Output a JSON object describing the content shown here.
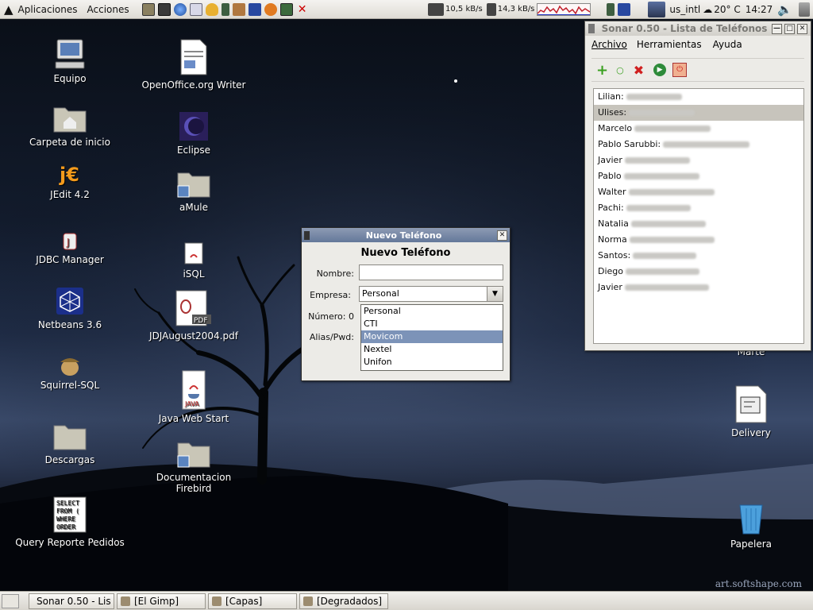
{
  "top_panel": {
    "menus": [
      "Aplicaciones",
      "Acciones"
    ],
    "net_down": "10,5 kB/s",
    "net_up": "14,3 kB/s",
    "keyboard_layout": "us_intl",
    "weather": "20° C",
    "clock": "14:27"
  },
  "desktop_icons": {
    "col1": [
      "Equipo",
      "Carpeta de inicio",
      "JEdit 4.2",
      "JDBC Manager",
      "Netbeans 3.6",
      "Squirrel-SQL",
      "Descargas",
      "Query Reporte Pedidos"
    ],
    "col2": [
      "OpenOffice.org Writer",
      "Eclipse",
      "aMule",
      "iSQL",
      "JDJAugust2004.pdf",
      "Java Web Start",
      "Documentacion Firebird"
    ],
    "right": [
      "Delivery",
      "Papelera"
    ],
    "partial": "Marte"
  },
  "sonar_window": {
    "title": "Sonar 0.50 - Lista de Teléfonos",
    "menu": [
      "Archivo",
      "Herramientas",
      "Ayuda"
    ],
    "contacts": [
      "Lilian:",
      "Ulises:",
      "Marcelo",
      "Pablo Sarubbi:",
      "Javier",
      "Pablo",
      "Walter",
      "Pachi:",
      "Natalia",
      "Norma",
      "Santos:",
      "Diego",
      "Javier"
    ],
    "selected_index": 1
  },
  "dialog": {
    "title": "Nuevo Teléfono",
    "heading": "Nuevo Teléfono",
    "labels": {
      "nombre": "Nombre:",
      "empresa": "Empresa:",
      "numero": "Número: 0",
      "alias": "Alias/Pwd:"
    },
    "nombre_value": "",
    "empresa_selected": "Personal",
    "empresa_options": [
      "Personal",
      "CTI",
      "Movicom",
      "Nextel",
      "Unifon"
    ],
    "highlighted_option": "Movicom"
  },
  "taskbar": {
    "tasks": [
      "Sonar 0.50 - Lis",
      "[El Gimp]",
      "[Capas]",
      "[Degradados]"
    ]
  },
  "watermark": "art.softshape.com",
  "colors": {
    "selection": "#7c93b8",
    "list_selected_row": "#c7c4bc",
    "panel": "#e6e3dd"
  }
}
